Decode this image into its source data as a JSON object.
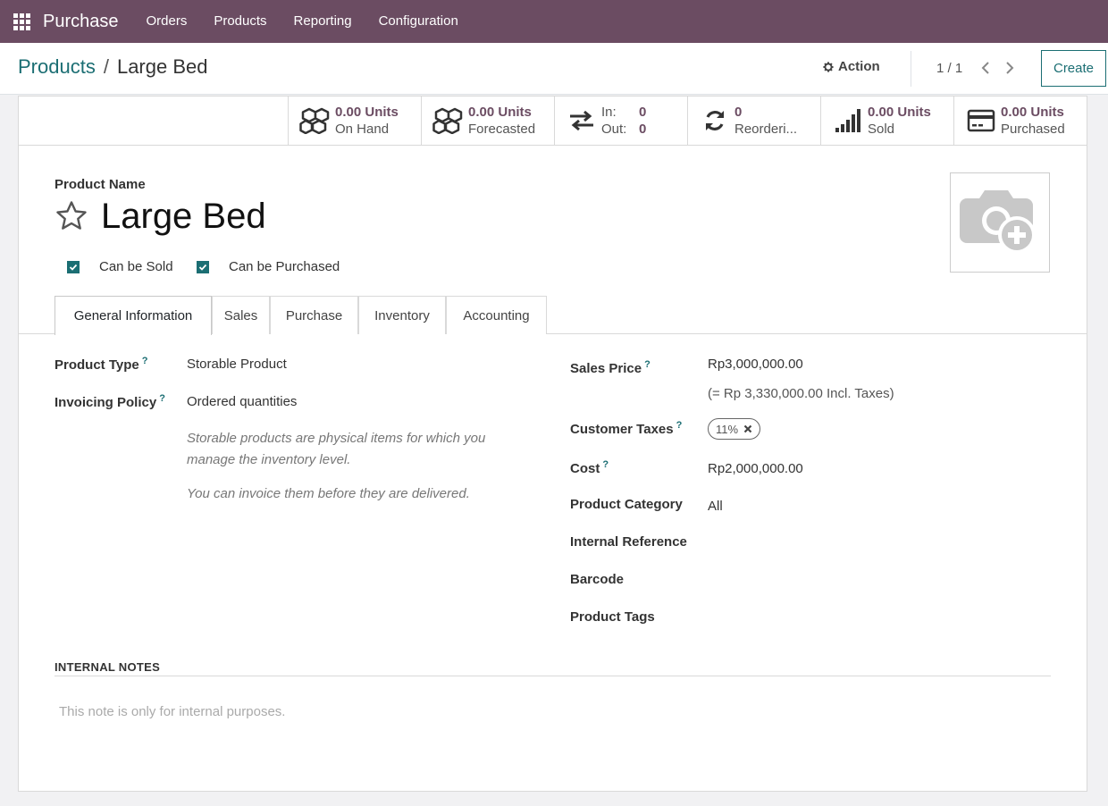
{
  "navbar": {
    "app_name": "Purchase",
    "menu": [
      "Orders",
      "Products",
      "Reporting",
      "Configuration"
    ]
  },
  "breadcrumb": {
    "parent": "Products",
    "separator": "/",
    "current": "Large Bed"
  },
  "toolbar": {
    "action_label": "Action",
    "pager": "1 / 1",
    "create_label": "Create"
  },
  "stats": [
    {
      "value": "0.00 Units",
      "label": "On Hand",
      "icon": "cubes-icon"
    },
    {
      "value": "0.00 Units",
      "label": "Forecasted",
      "icon": "cubes-icon"
    },
    {
      "in_label": "In:",
      "in_value": "0",
      "out_label": "Out:",
      "out_value": "0",
      "icon": "exchange-icon"
    },
    {
      "value": "0",
      "label": "Reorderi...",
      "icon": "refresh-icon"
    },
    {
      "value": "0.00 Units",
      "label": "Sold",
      "icon": "signal-icon"
    },
    {
      "value": "0.00 Units",
      "label": "Purchased",
      "icon": "credit-card-icon"
    }
  ],
  "product": {
    "name_label": "Product Name",
    "name": "Large Bed",
    "can_be_sold_label": "Can be Sold",
    "can_be_purchased_label": "Can be Purchased",
    "can_be_sold": true,
    "can_be_purchased": true
  },
  "tabs": [
    "General Information",
    "Sales",
    "Purchase",
    "Inventory",
    "Accounting"
  ],
  "active_tab": "General Information",
  "general": {
    "product_type_label": "Product Type",
    "product_type": "Storable Product",
    "invoicing_policy_label": "Invoicing Policy",
    "invoicing_policy": "Ordered quantities",
    "help_storable_1": "Storable products are physical items for which you",
    "help_storable_2": "manage the inventory level.",
    "help_invoice": "You can invoice them before they are delivered.",
    "sales_price_label": "Sales Price",
    "sales_price": "Rp3,000,000.00",
    "sales_price_incl": "(= Rp 3,330,000.00 Incl. Taxes)",
    "customer_taxes_label": "Customer Taxes",
    "customer_tax": "11%",
    "cost_label": "Cost",
    "cost": "Rp2,000,000.00",
    "category_label": "Product Category",
    "category": "All",
    "internal_ref_label": "Internal Reference",
    "barcode_label": "Barcode",
    "tags_label": "Product Tags",
    "help_mark": "?"
  },
  "notes": {
    "title": "INTERNAL NOTES",
    "placeholder": "This note is only for internal purposes."
  },
  "colors": {
    "navbar": "#6b4c62",
    "accent": "#1b6e73",
    "stat_value": "#6b4c62"
  }
}
